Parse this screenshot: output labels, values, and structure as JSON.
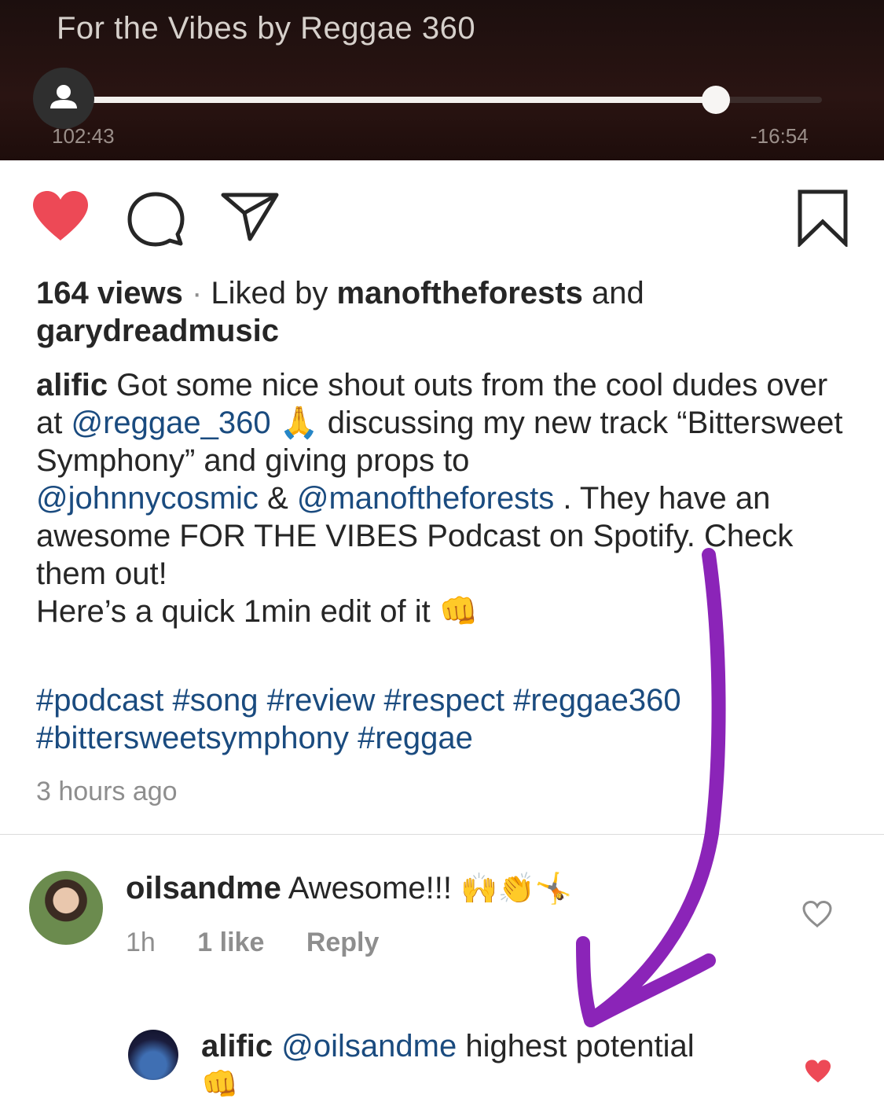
{
  "player": {
    "title": "For the Vibes by Reggae 360",
    "elapsed": "102:43",
    "remaining": "-16:54",
    "progress": 0.86
  },
  "post": {
    "views": "164 views",
    "liked_prefix": "Liked by",
    "liker1": "manoftheforests",
    "liked_and": "and",
    "liker2": "garydreadmusic",
    "caption_user": "alific",
    "caption_seg1": "Got some nice shout outs from the cool dudes over at",
    "mention1": "@reggae_360",
    "emoji_pray": "🙏",
    "caption_seg2": "discussing my new track “Bittersweet Symphony” and giving props to",
    "mention2": "@johnnycosmic",
    "amp": "&",
    "mention3": "@manoftheforests",
    "caption_seg3": ". They have an awesome FOR THE VIBES Podcast on Spotify. Check them out!",
    "caption_line2": "Here’s a quick 1min edit of it",
    "emoji_fist": "👊",
    "hashtags": [
      "#podcast",
      "#song",
      "#review",
      "#respect",
      "#reggae360",
      "#bittersweetsymphony",
      "#reggae"
    ],
    "timestamp": "3 hours ago"
  },
  "comments": [
    {
      "user": "oilsandme",
      "text": "Awesome!!!",
      "emojis": "🙌👏🤸",
      "time": "1h",
      "likes": "1 like",
      "reply": "Reply"
    },
    {
      "user": "alific",
      "mention": "@oilsandme",
      "text": "highest potential",
      "emoji": "👊"
    }
  ],
  "colors": {
    "like_red": "#ed4956",
    "link_blue": "#1a4b7f",
    "arrow_purple": "#8b24b8"
  },
  "icons": [
    "heart-icon",
    "comment-icon",
    "share-icon",
    "bookmark-icon",
    "user-icon",
    "heart-outline-icon",
    "heart-filled-icon"
  ]
}
